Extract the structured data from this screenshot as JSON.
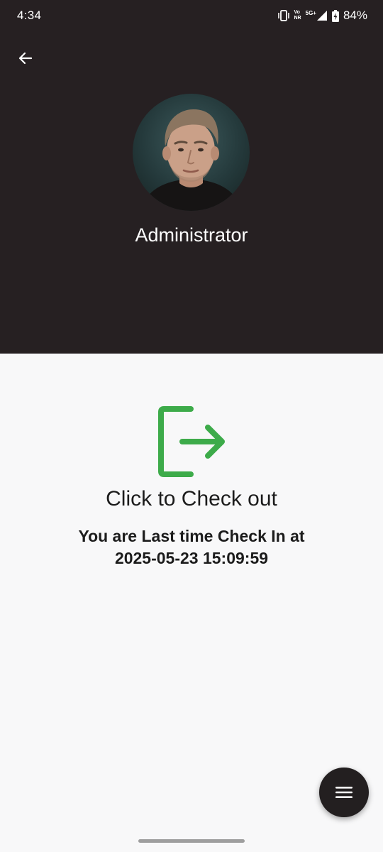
{
  "status_bar": {
    "time": "4:34",
    "volte_top": "Vo",
    "volte_bottom": "NR",
    "network": "5G+",
    "battery_percent": "84%"
  },
  "header": {
    "user_name": "Administrator"
  },
  "checkout": {
    "label": "Click to Check out",
    "last_checkin_line1": "You are Last time Check In at",
    "last_checkin_line2": "2025-05-23 15:09:59"
  },
  "icons": {
    "back": "arrow-left-icon",
    "checkout": "logout-icon",
    "menu": "menu-icon"
  },
  "colors": {
    "header_bg": "#262022",
    "body_bg": "#f8f8f9",
    "accent_green": "#3dab4a",
    "fab_bg": "#231f20"
  }
}
